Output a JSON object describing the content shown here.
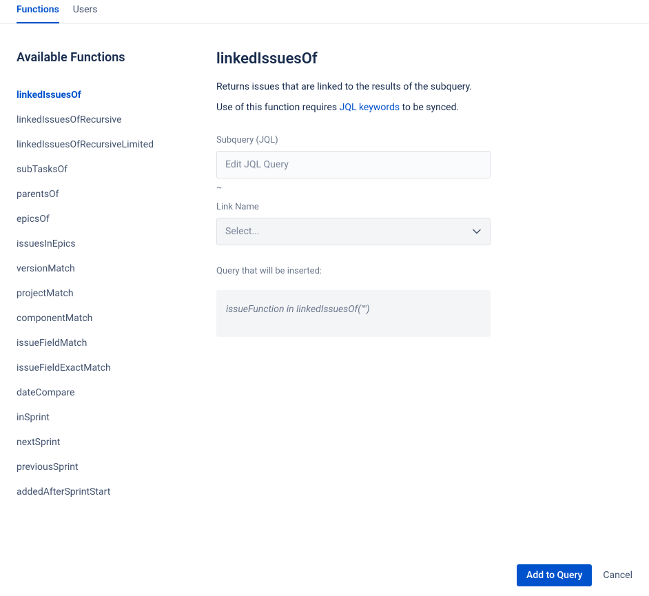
{
  "tabs": {
    "functions": "Functions",
    "users": "Users"
  },
  "sidebar": {
    "title": "Available Functions",
    "items": [
      "linkedIssuesOf",
      "linkedIssuesOfRecursive",
      "linkedIssuesOfRecursiveLimited",
      "subTasksOf",
      "parentsOf",
      "epicsOf",
      "issuesInEpics",
      "versionMatch",
      "projectMatch",
      "componentMatch",
      "issueFieldMatch",
      "issueFieldExactMatch",
      "dateCompare",
      "inSprint",
      "nextSprint",
      "previousSprint",
      "addedAfterSprintStart"
    ]
  },
  "main": {
    "title": "linkedIssuesOf",
    "description": "Returns issues that are linked to the results of the subquery.",
    "usage_prefix": "Use of this function requires ",
    "usage_link": "JQL keywords",
    "usage_suffix": " to be synced.",
    "subquery_label": "Subquery (JQL)",
    "subquery_placeholder": "Edit JQL Query",
    "tilde": "~",
    "linkname_label": "Link Name",
    "linkname_placeholder": "Select...",
    "preview_label": "Query that will be inserted:",
    "preview_query": "issueFunction in linkedIssuesOf(\"\")"
  },
  "footer": {
    "add": "Add to Query",
    "cancel": "Cancel"
  }
}
